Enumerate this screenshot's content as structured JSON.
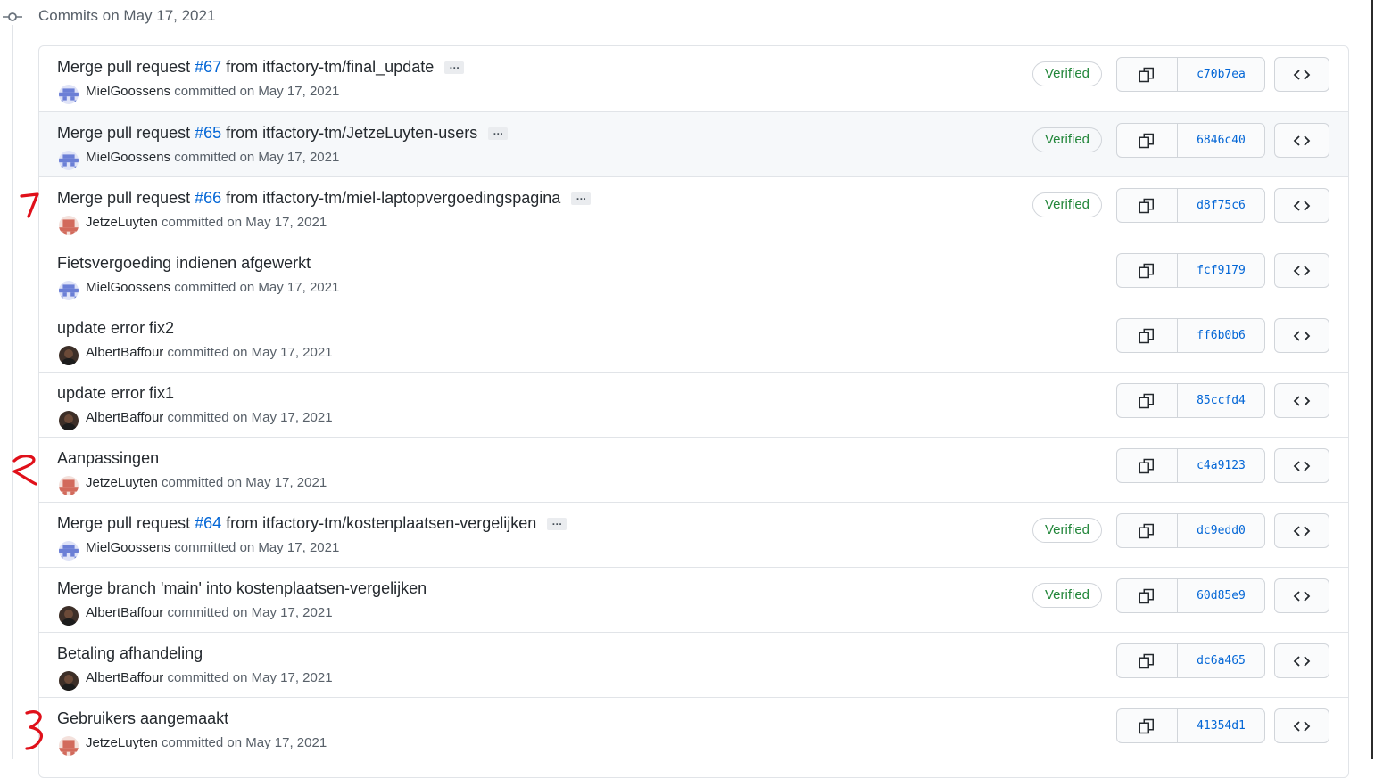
{
  "date_header": "Commits on May 17, 2021",
  "commits": [
    {
      "pre": "Merge pull request ",
      "pr": "#67",
      "post": " from itfactory-tm/final_update",
      "author": "MielGoossens",
      "committed": " committed on May 17, 2021",
      "verified": "Verified",
      "sha": "c70b7ea"
    },
    {
      "pre": "Merge pull request ",
      "pr": "#65",
      "post": " from itfactory-tm/JetzeLuyten-users",
      "author": "MielGoossens",
      "committed": " committed on May 17, 2021",
      "verified": "Verified",
      "sha": "6846c40"
    },
    {
      "pre": "Merge pull request ",
      "pr": "#66",
      "post": " from itfactory-tm/miel-laptopvergoedingspagina",
      "author": "JetzeLuyten",
      "committed": " committed on May 17, 2021",
      "verified": "Verified",
      "sha": "d8f75c6"
    },
    {
      "pre": "Fietsvergoeding indienen afgewerkt",
      "author": "MielGoossens",
      "committed": " committed on May 17, 2021",
      "sha": "fcf9179"
    },
    {
      "pre": "update error fix2",
      "author": "AlbertBaffour",
      "committed": " committed on May 17, 2021",
      "sha": "ff6b0b6"
    },
    {
      "pre": "update error fix1",
      "author": "AlbertBaffour",
      "committed": " committed on May 17, 2021",
      "sha": "85ccfd4"
    },
    {
      "pre": "Aanpassingen",
      "author": "JetzeLuyten",
      "committed": " committed on May 17, 2021",
      "sha": "c4a9123"
    },
    {
      "pre": "Merge pull request ",
      "pr": "#64",
      "post": " from itfactory-tm/kostenplaatsen-vergelijken",
      "author": "MielGoossens",
      "committed": " committed on May 17, 2021",
      "verified": "Verified",
      "sha": "dc9edd0"
    },
    {
      "pre": "Merge branch 'main' into kostenplaatsen-vergelijken",
      "author": "AlbertBaffour",
      "committed": " committed on May 17, 2021",
      "verified": "Verified",
      "sha": "60d85e9"
    },
    {
      "pre": "Betaling afhandeling",
      "author": "AlbertBaffour",
      "committed": " committed on May 17, 2021",
      "sha": "dc6a465"
    },
    {
      "pre": "Gebruikers aangemaakt",
      "author": "JetzeLuyten",
      "committed": " committed on May 17, 2021",
      "sha": "41354d1"
    }
  ],
  "colors": {
    "link": "#0366d6",
    "verified": "#22863a",
    "annotation": "#e0101a"
  }
}
